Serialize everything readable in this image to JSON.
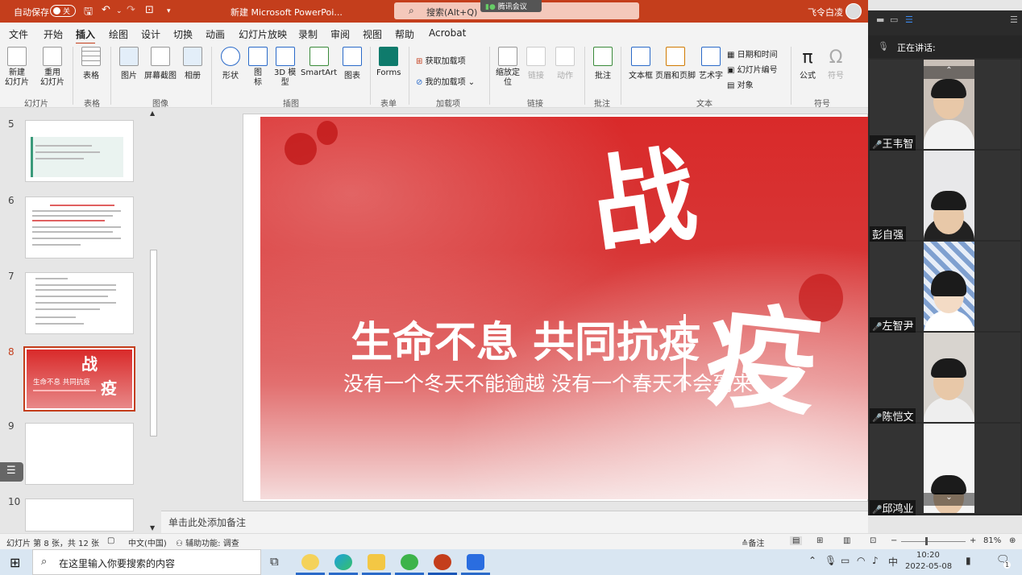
{
  "titlebar": {
    "autosave_label": "自动保存",
    "autosave_state": "关",
    "doc_title": "新建 Microsoft PowerPoi...",
    "search_placeholder": "搜索(Alt+Q)",
    "user": "飞令白凌",
    "meeting_badge": "腾讯会议"
  },
  "menu": [
    "文件",
    "开始",
    "插入",
    "绘图",
    "设计",
    "切换",
    "动画",
    "幻灯片放映",
    "录制",
    "审阅",
    "视图",
    "帮助",
    "Acrobat"
  ],
  "menu_active": "插入",
  "ribbon": {
    "new_slide": "新建\n幻灯片",
    "reuse_slide": "重用\n幻灯片",
    "table": "表格",
    "picture": "图片",
    "screenshot": "屏幕截图",
    "album": "相册",
    "shape": "形状",
    "icon": "图\n标",
    "model3d": "3D 模\n型",
    "smartart": "SmartArt",
    "chart": "图表",
    "forms": "Forms",
    "get_addins": "获取加载项",
    "my_addins": "我的加载项",
    "zoom": "缩放定\n位",
    "link": "链接",
    "action": "动作",
    "comment": "批注",
    "textbox": "文本框",
    "header_footer": "页眉和页脚",
    "wordart": "艺术字",
    "datetime": "日期和时间",
    "slide_number": "幻灯片编号",
    "object": "对象",
    "equation": "公式",
    "symbol": "符号",
    "groups": {
      "slides": "幻灯片",
      "tables": "表格",
      "images": "图像",
      "illustrations": "插图",
      "forms": "表单",
      "addins": "加载项",
      "links": "链接",
      "comments": "批注",
      "text": "文本",
      "symbols": "符号"
    }
  },
  "thumbnails": [
    "5",
    "6",
    "7",
    "8",
    "9",
    "10"
  ],
  "selected_slide": "8",
  "slide": {
    "big_char_1": "战",
    "big_char_2": "疫",
    "headline": "生命不息  共同抗疫",
    "subline": "没有一个冬天不能逾越  没有一个春天不会到来",
    "thumb_headline": "生命不息  共同抗疫"
  },
  "notes_placeholder": "单击此处添加备注",
  "status": {
    "slide_count": "幻灯片 第 8 张，共 12 张",
    "language": "中文(中国)",
    "accessibility": "辅助功能: 调查",
    "notes": "备注",
    "zoom": "81%"
  },
  "taskbar": {
    "search_placeholder": "在这里输入你要搜索的内容",
    "ime": "中",
    "time": "10:20",
    "date": "2022-05-08",
    "notif": "1"
  },
  "meeting": {
    "speaking": "正在讲话:",
    "participants": [
      "王韦智",
      "彭自强",
      "左智尹",
      "陈恺文",
      "邱鸿业"
    ]
  },
  "colors": {
    "accent": "#c43e1c",
    "slide_red": "#d92a2a"
  }
}
